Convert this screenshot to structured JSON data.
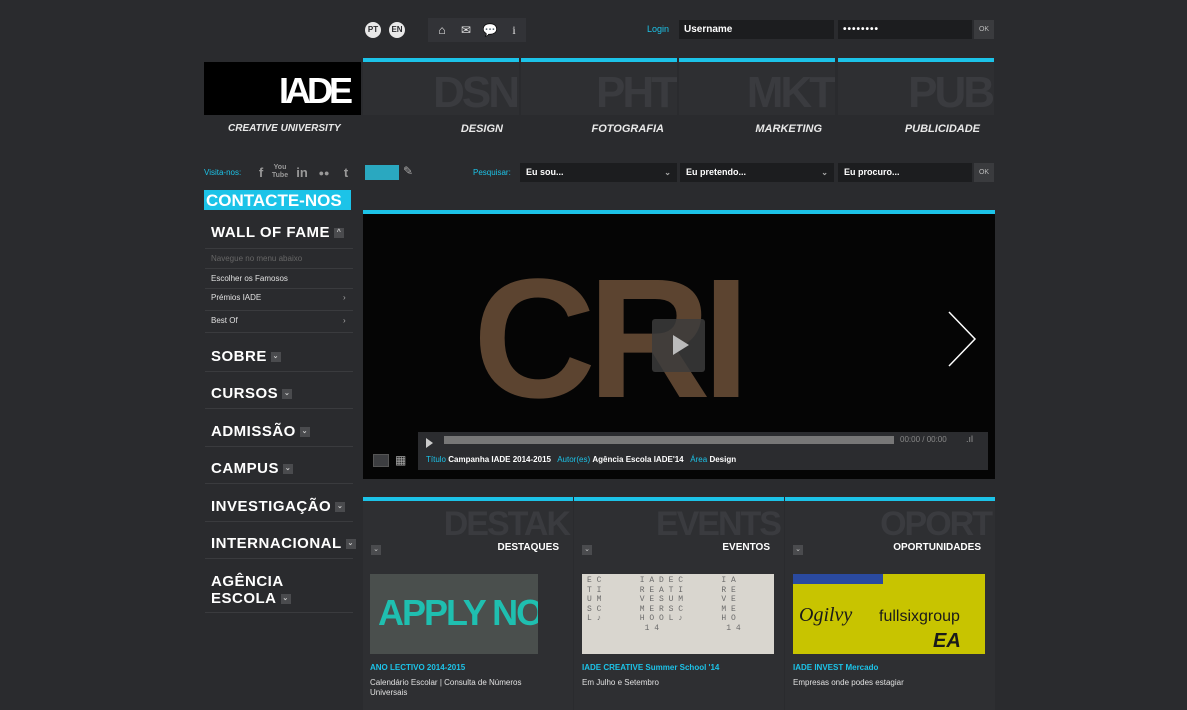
{
  "topbar": {
    "lang_pt": "PT",
    "lang_en": "EN",
    "login_label": "Login",
    "username_value": "Username",
    "password_value": "••••••••",
    "ok_label": "OK"
  },
  "brand": {
    "logo_text": "IADE",
    "tagline": "CREATIVE UNIVERSITY"
  },
  "nav": [
    {
      "abbr": "DSN",
      "label": "DESIGN"
    },
    {
      "abbr": "PHT",
      "label": "FOTOGRAFIA"
    },
    {
      "abbr": "MKT",
      "label": "MARKETING"
    },
    {
      "abbr": "PUB",
      "label": "PUBLICIDADE"
    }
  ],
  "social": {
    "visit_label": "Visita-nos:"
  },
  "search": {
    "label": "Pesquisar:",
    "select1": "Eu sou...",
    "select2": "Eu pretendo...",
    "select3": "Eu procuro...",
    "ok_label": "OK"
  },
  "sidebar": {
    "contact": "CONTACTE-NOS",
    "wall_of_fame": "WALL OF FAME",
    "nav_hint": "Navegue no menu abaixo",
    "sub_items": [
      "Escolher os Famosos",
      "Prémios IADE",
      "Best Of"
    ],
    "sections": [
      "SOBRE",
      "CURSOS",
      "ADMISSÃO",
      "CAMPUS",
      "INVESTIGAÇÃO",
      "INTERNACIONAL"
    ],
    "agencia_line1": "AGÊNCIA",
    "agencia_line2": "ESCOLA"
  },
  "video": {
    "overlay_text": "CRI",
    "time": "00:00 / 00:00",
    "title_label": "Título",
    "title_value": "Campanha IADE 2014-2015",
    "author_label": "Autor(es)",
    "author_value": "Agência Escola IADE'14",
    "area_label": "Área",
    "area_value": "Design"
  },
  "cards": [
    {
      "abbr": "DESTAK",
      "label": "DESTAQUES",
      "title": "ANO LECTIVO 2014-2015",
      "desc": "Calendário Escolar | Consulta de Números Universais",
      "image_text": "APPLY NOW"
    },
    {
      "abbr": "EVENTS",
      "label": "EVENTOS",
      "title": "IADE CREATIVE Summer School '14",
      "desc": "Em Julho e Setembro",
      "image_text": ""
    },
    {
      "abbr": "OPORT",
      "label": "OPORTUNIDADES",
      "title": "IADE INVEST Mercado",
      "desc": "Empresas onde podes estagiar",
      "image_text": "fullsixgroup"
    }
  ],
  "colors": {
    "accent": "#1cc3e8",
    "background": "#2a2b2e",
    "panel": "#2e2f32"
  }
}
